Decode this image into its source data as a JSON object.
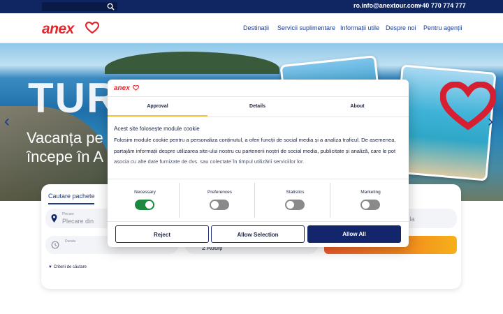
{
  "topbar": {
    "email": "ro.info@anextour.com",
    "phone": "+40 770 774 777"
  },
  "header": {
    "logo_text": "anex",
    "nav": [
      "Destinații",
      "Servicii suplimentare",
      "Informații utile",
      "Despre noi",
      "Pentru agenții"
    ]
  },
  "hero": {
    "title": "TUR",
    "subtitle_line1": "Vacanța pe",
    "subtitle_line2": "începe în A"
  },
  "search": {
    "tab": "Cautare pachete",
    "departure_label": "Plecare",
    "departure_placeholder": "Plecare din",
    "duration_label": "Durata",
    "date_placeholder": "ă la",
    "travellers_value": "2 Adulți",
    "criteria": "Criterii de căutare"
  },
  "cookie": {
    "logo_text": "anex",
    "tabs": [
      "Approval",
      "Details",
      "About"
    ],
    "heading": "Acest site folosește module cookie",
    "body": "Folosim module cookie pentru a personaliza conținutul, a oferi funcții de social media și a analiza traficul. De asemenea, partajăm informații despre utilizarea site-ului nostru cu partenerii noștri de social media, publicitate și analiză, care le pot asocia cu alte date furnizate de dvs. sau colectate în timpul utilizării serviciilor lor.",
    "toggles": [
      {
        "label": "Necessary",
        "on": true
      },
      {
        "label": "Preferences",
        "on": false
      },
      {
        "label": "Statistics",
        "on": false
      },
      {
        "label": "Marketing",
        "on": false
      }
    ],
    "buttons": {
      "reject": "Reject",
      "allow_selection": "Allow Selection",
      "allow_all": "Allow All"
    }
  },
  "colors": {
    "brand_red": "#e4262c",
    "brand_blue": "#14266b",
    "toggle_on": "#1b8a3f"
  }
}
